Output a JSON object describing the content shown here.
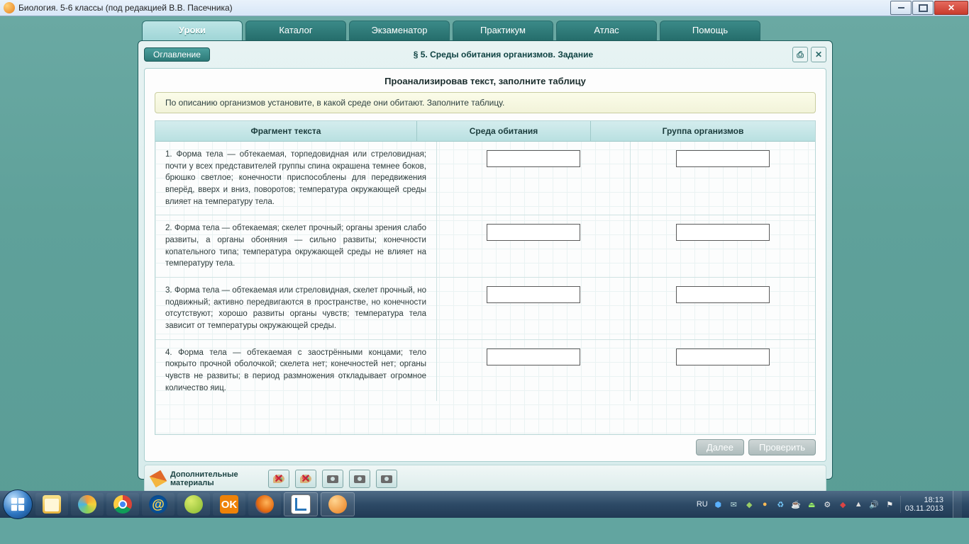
{
  "window": {
    "title": "Биология. 5-6 классы (под редакцией В.В. Пасечника)"
  },
  "tabs": {
    "t1": "Уроки",
    "t2": "Каталог",
    "t3": "Экзаменатор",
    "t4": "Практикум",
    "t5": "Атлас",
    "t6": "Помощь"
  },
  "subheader": {
    "toc": "Оглавление",
    "section": "§ 5. Среды обитания организмов. Задание"
  },
  "task": {
    "title": "Проанализировав текст, заполните таблицу",
    "hint": "По описанию организмов установите, в какой среде они обитают. Заполните таблицу."
  },
  "columns": {
    "a": "Фрагмент текста",
    "b": "Среда обитания",
    "c": "Группа организмов"
  },
  "rows": {
    "r1": "1. Форма тела — обтекаемая, торпедовидная или стреловидная; почти у всех представителей группы спина окрашена темнее боков, брюшко светлое; конечности приспособлены для передвижения вперёд, вверх и вниз, поворотов; температура окружающей среды влияет на температуру тела.",
    "r2": "2. Форма тела — обтекаемая; скелет прочный; органы зрения слабо развиты, а органы обоняния — сильно развиты; конечности копательного типа; температура окружающей среды не влияет на температуру тела.",
    "r3": "3. Форма тела — обтекаемая или стреловидная, скелет прочный, но подвижный; активно передвигаются в пространстве, но конечности отсутствуют; хорошо развиты органы чувств; температура тела зависит от температуры окружающей среды.",
    "r4": "4. Форма тела — обтекаемая с заострёнными концами; тело покрыто прочной оболочкой; скелета нет; конечностей нет; органы чувств не развиты; в период размножения откладывает огромное количество яиц."
  },
  "buttons": {
    "next": "Далее",
    "check": "Проверить"
  },
  "materials": {
    "label": "Дополнительные материалы"
  },
  "systray": {
    "lang": "RU",
    "time": "18:13",
    "date": "03.11.2013"
  }
}
